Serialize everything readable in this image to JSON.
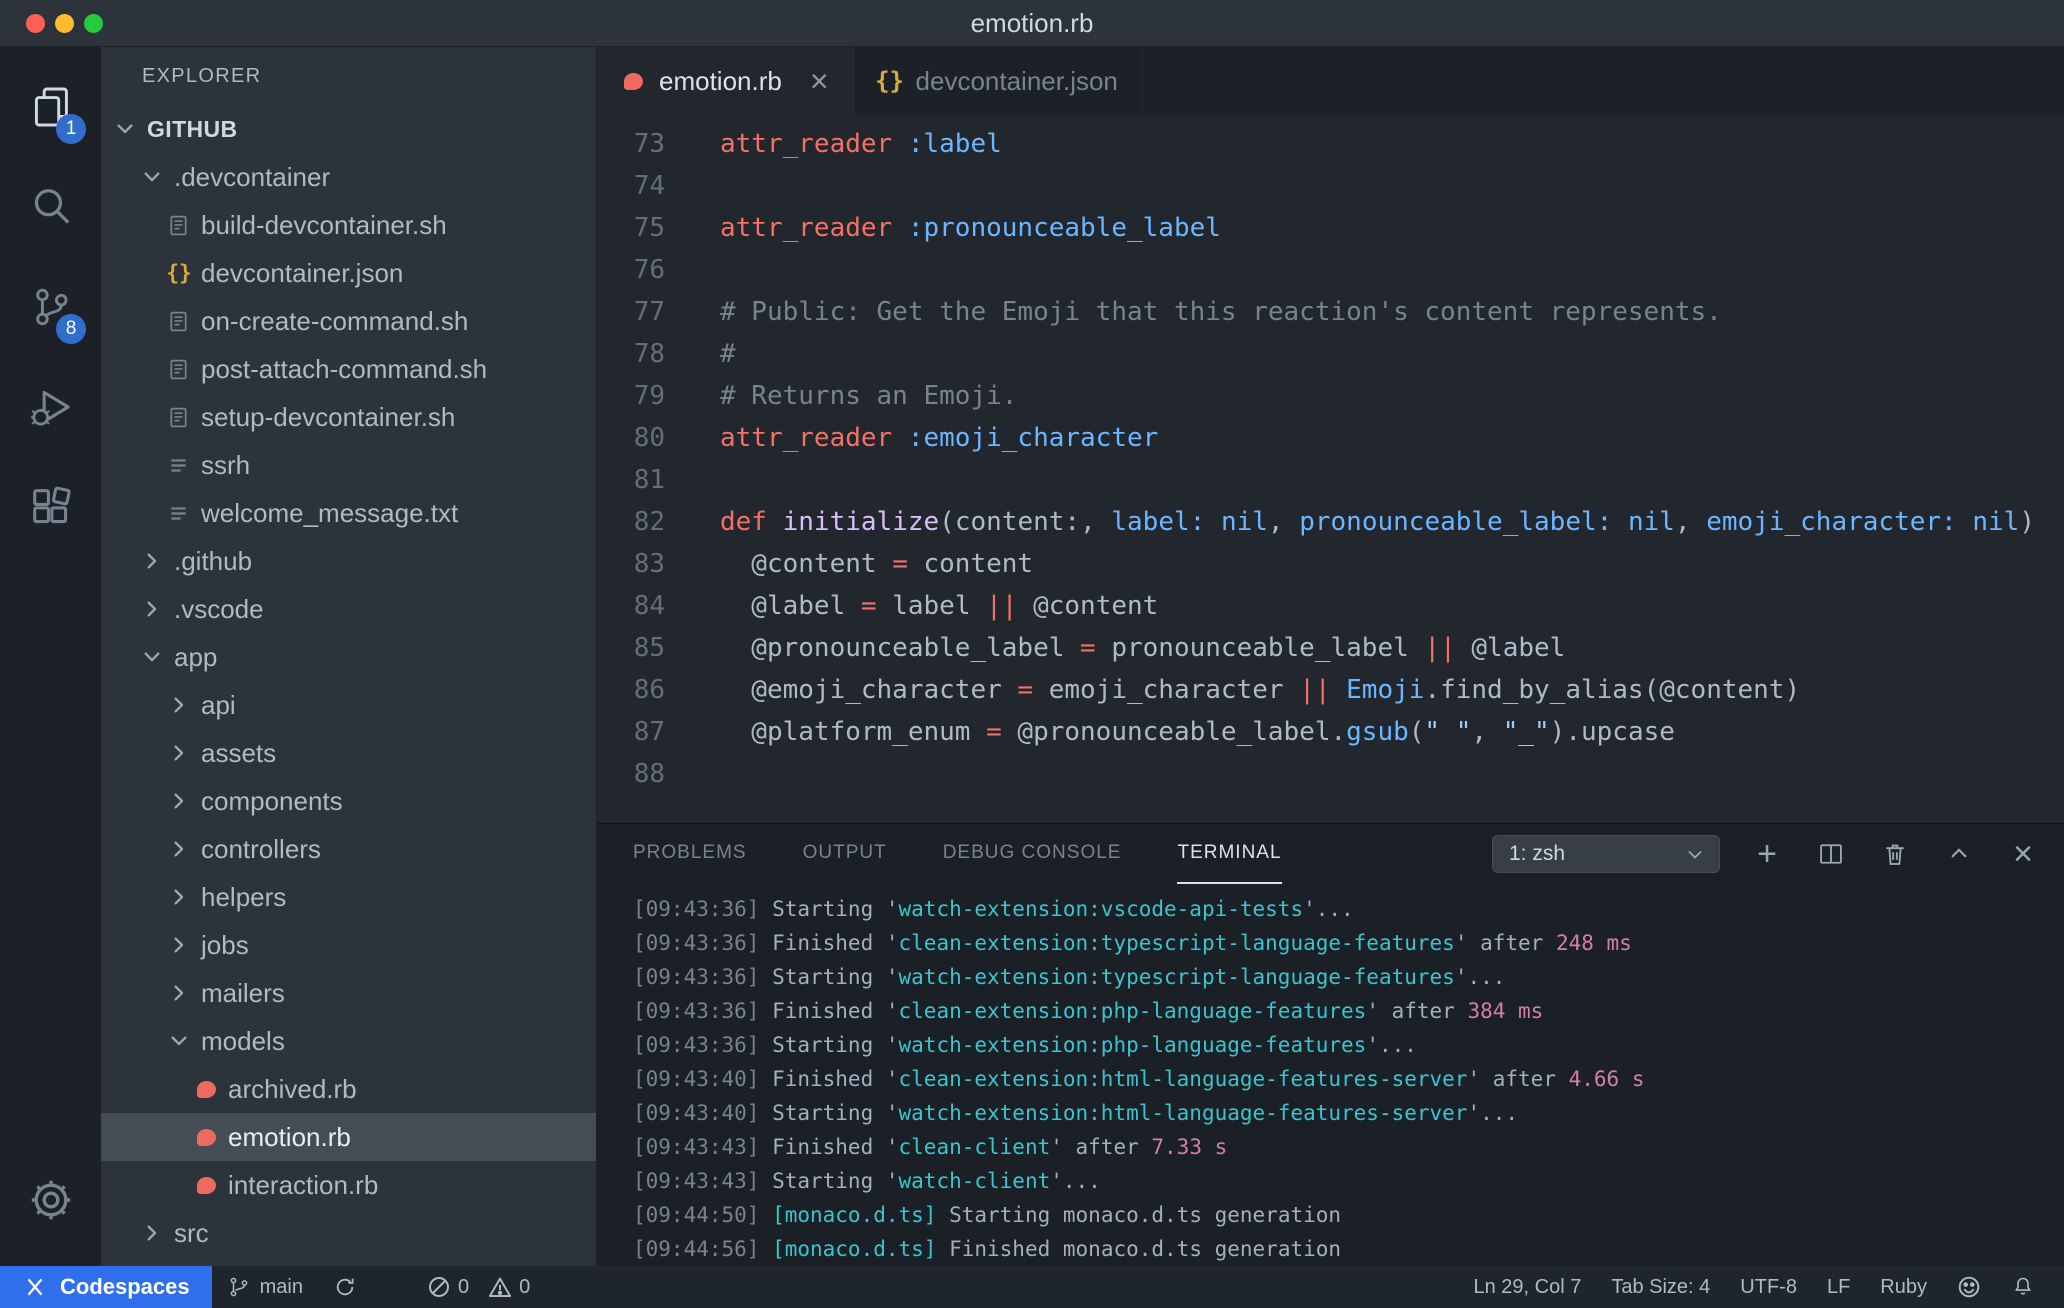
{
  "titlebar": {
    "title": "emotion.rb"
  },
  "activity_bar": {
    "explorer_badge": "1",
    "source_control_badge": "8"
  },
  "sidebar": {
    "header": "EXPLORER",
    "tree": [
      {
        "label": "GITHUB",
        "kind": "root",
        "level": 0,
        "expanded": true
      },
      {
        "label": ".devcontainer",
        "kind": "folder",
        "level": 1,
        "expanded": true
      },
      {
        "label": "build-devcontainer.sh",
        "kind": "file",
        "icon": "shell",
        "level": 2
      },
      {
        "label": "devcontainer.json",
        "kind": "file",
        "icon": "json",
        "level": 2
      },
      {
        "label": "on-create-command.sh",
        "kind": "file",
        "icon": "shell",
        "level": 2
      },
      {
        "label": "post-attach-command.sh",
        "kind": "file",
        "icon": "shell",
        "level": 2
      },
      {
        "label": "setup-devcontainer.sh",
        "kind": "file",
        "icon": "shell",
        "level": 2
      },
      {
        "label": "ssrh",
        "kind": "file",
        "icon": "text",
        "level": 2
      },
      {
        "label": "welcome_message.txt",
        "kind": "file",
        "icon": "text",
        "level": 2
      },
      {
        "label": ".github",
        "kind": "folder",
        "level": 1,
        "expanded": false
      },
      {
        "label": ".vscode",
        "kind": "folder",
        "level": 1,
        "expanded": false
      },
      {
        "label": "app",
        "kind": "folder",
        "level": 1,
        "expanded": true
      },
      {
        "label": "api",
        "kind": "folder",
        "level": 2,
        "expanded": false
      },
      {
        "label": "assets",
        "kind": "folder",
        "level": 2,
        "expanded": false
      },
      {
        "label": "components",
        "kind": "folder",
        "level": 2,
        "expanded": false
      },
      {
        "label": "controllers",
        "kind": "folder",
        "level": 2,
        "expanded": false
      },
      {
        "label": "helpers",
        "kind": "folder",
        "level": 2,
        "expanded": false
      },
      {
        "label": "jobs",
        "kind": "folder",
        "level": 2,
        "expanded": false
      },
      {
        "label": "mailers",
        "kind": "folder",
        "level": 2,
        "expanded": false
      },
      {
        "label": "models",
        "kind": "folder",
        "level": 2,
        "expanded": true
      },
      {
        "label": "archived.rb",
        "kind": "file",
        "icon": "ruby",
        "level": 3
      },
      {
        "label": "emotion.rb",
        "kind": "file",
        "icon": "ruby",
        "level": 3,
        "selected": true
      },
      {
        "label": "interaction.rb",
        "kind": "file",
        "icon": "ruby",
        "level": 3
      },
      {
        "label": "src",
        "kind": "folder",
        "level": 1,
        "expanded": false
      }
    ]
  },
  "tabs": [
    {
      "label": "emotion.rb",
      "icon": "ruby",
      "active": true,
      "closable": true
    },
    {
      "label": "devcontainer.json",
      "icon": "json",
      "active": false,
      "closable": false
    }
  ],
  "editor": {
    "lines": [
      {
        "num": 73,
        "segs": [
          [
            "r",
            "attr_reader"
          ],
          [
            "w",
            " "
          ],
          [
            "b",
            ":label"
          ]
        ]
      },
      {
        "num": 74,
        "segs": []
      },
      {
        "num": 75,
        "segs": [
          [
            "r",
            "attr_reader"
          ],
          [
            "w",
            " "
          ],
          [
            "b",
            ":pronounceable_label"
          ]
        ]
      },
      {
        "num": 76,
        "segs": []
      },
      {
        "num": 77,
        "segs": [
          [
            "c",
            "# Public: Get the Emoji that this reaction's content represents."
          ]
        ]
      },
      {
        "num": 78,
        "segs": [
          [
            "c",
            "#"
          ]
        ]
      },
      {
        "num": 79,
        "segs": [
          [
            "c",
            "# Returns an Emoji."
          ]
        ]
      },
      {
        "num": 80,
        "segs": [
          [
            "r",
            "attr_reader"
          ],
          [
            "w",
            " "
          ],
          [
            "b",
            ":emoji_character"
          ]
        ]
      },
      {
        "num": 81,
        "segs": []
      },
      {
        "num": 82,
        "segs": [
          [
            "r",
            "def"
          ],
          [
            "w",
            " "
          ],
          [
            "p",
            "initialize"
          ],
          [
            "w",
            "(content:, "
          ],
          [
            "b",
            "label:"
          ],
          [
            "w",
            " "
          ],
          [
            "b",
            "nil"
          ],
          [
            "w",
            ", "
          ],
          [
            "b",
            "pronounceable_label:"
          ],
          [
            "w",
            " "
          ],
          [
            "b",
            "nil"
          ],
          [
            "w",
            ", "
          ],
          [
            "b",
            "emoji_character:"
          ],
          [
            "w",
            " "
          ],
          [
            "b",
            "nil"
          ],
          [
            "w",
            ")"
          ]
        ]
      },
      {
        "num": 83,
        "segs": [
          [
            "w",
            "  @content "
          ],
          [
            "r",
            "="
          ],
          [
            "w",
            " content"
          ]
        ]
      },
      {
        "num": 84,
        "segs": [
          [
            "w",
            "  @label "
          ],
          [
            "r",
            "="
          ],
          [
            "w",
            " label "
          ],
          [
            "r",
            "||"
          ],
          [
            "w",
            " @content"
          ]
        ]
      },
      {
        "num": 85,
        "segs": [
          [
            "w",
            "  @pronounceable_label "
          ],
          [
            "r",
            "="
          ],
          [
            "w",
            " pronounceable_label "
          ],
          [
            "r",
            "||"
          ],
          [
            "w",
            " @label"
          ]
        ]
      },
      {
        "num": 86,
        "segs": [
          [
            "w",
            "  @emoji_character "
          ],
          [
            "r",
            "="
          ],
          [
            "w",
            " emoji_character "
          ],
          [
            "r",
            "||"
          ],
          [
            "w",
            " "
          ],
          [
            "b",
            "Emoji"
          ],
          [
            "w",
            ".find_by_alias(@content)"
          ]
        ]
      },
      {
        "num": 87,
        "segs": [
          [
            "w",
            "  @platform_enum "
          ],
          [
            "r",
            "="
          ],
          [
            "w",
            " @pronounceable_label."
          ],
          [
            "b",
            "gsub"
          ],
          [
            "w",
            "("
          ],
          [
            "s",
            "\" \""
          ],
          [
            "w",
            ", "
          ],
          [
            "s",
            "\"_\""
          ],
          [
            "w",
            ").upcase"
          ]
        ]
      },
      {
        "num": 88,
        "segs": []
      }
    ]
  },
  "panel": {
    "tabs": [
      "PROBLEMS",
      "OUTPUT",
      "DEBUG CONSOLE",
      "TERMINAL"
    ],
    "active_tab": "TERMINAL",
    "shell_selector": "1: zsh",
    "terminal_lines": [
      [
        [
          "g",
          "[09:43:36] "
        ],
        [
          "w",
          "Starting '"
        ],
        [
          "c",
          "watch-extension:vscode-api-tests"
        ],
        [
          "w",
          "'..."
        ]
      ],
      [
        [
          "g",
          "[09:43:36] "
        ],
        [
          "w",
          "Finished '"
        ],
        [
          "c",
          "clean-extension:typescript-language-features"
        ],
        [
          "w",
          "' after "
        ],
        [
          "m",
          "248 ms"
        ]
      ],
      [
        [
          "g",
          "[09:43:36] "
        ],
        [
          "w",
          "Starting '"
        ],
        [
          "c",
          "watch-extension:typescript-language-features"
        ],
        [
          "w",
          "'..."
        ]
      ],
      [
        [
          "g",
          "[09:43:36] "
        ],
        [
          "w",
          "Finished '"
        ],
        [
          "c",
          "clean-extension:php-language-features"
        ],
        [
          "w",
          "' after "
        ],
        [
          "m",
          "384 ms"
        ]
      ],
      [
        [
          "g",
          "[09:43:36] "
        ],
        [
          "w",
          "Starting '"
        ],
        [
          "c",
          "watch-extension:php-language-features"
        ],
        [
          "w",
          "'..."
        ]
      ],
      [
        [
          "g",
          "[09:43:40] "
        ],
        [
          "w",
          "Finished '"
        ],
        [
          "c",
          "clean-extension:html-language-features-server"
        ],
        [
          "w",
          "' after "
        ],
        [
          "m",
          "4.66 s"
        ]
      ],
      [
        [
          "g",
          "[09:43:40] "
        ],
        [
          "w",
          "Starting '"
        ],
        [
          "c",
          "watch-extension:html-language-features-server"
        ],
        [
          "w",
          "'..."
        ]
      ],
      [
        [
          "g",
          "[09:43:43] "
        ],
        [
          "w",
          "Finished '"
        ],
        [
          "c",
          "clean-client"
        ],
        [
          "w",
          "' after "
        ],
        [
          "m",
          "7.33 s"
        ]
      ],
      [
        [
          "g",
          "[09:43:43] "
        ],
        [
          "w",
          "Starting '"
        ],
        [
          "c",
          "watch-client"
        ],
        [
          "w",
          "'..."
        ]
      ],
      [
        [
          "g",
          "[09:44:50] "
        ],
        [
          "c",
          "[monaco.d.ts]"
        ],
        [
          "w",
          " Starting monaco.d.ts generation"
        ]
      ],
      [
        [
          "g",
          "[09:44:56] "
        ],
        [
          "c",
          "[monaco.d.ts]"
        ],
        [
          "w",
          " Finished monaco.d.ts generation"
        ]
      ]
    ]
  },
  "status_bar": {
    "codespaces": "Codespaces",
    "branch": "main",
    "errors": "0",
    "warnings": "0",
    "line_col": "Ln 29, Col 7",
    "tab_size": "Tab Size: 4",
    "encoding": "UTF-8",
    "eol": "LF",
    "language": "Ruby"
  },
  "icons": {
    "close": "×",
    "plus": "+"
  },
  "colors": {
    "accent_blue": "#2f6feb",
    "badge_blue": "#316dca",
    "ruby_red": "#ec6a5e",
    "json_yellow": "#daaa3f"
  }
}
